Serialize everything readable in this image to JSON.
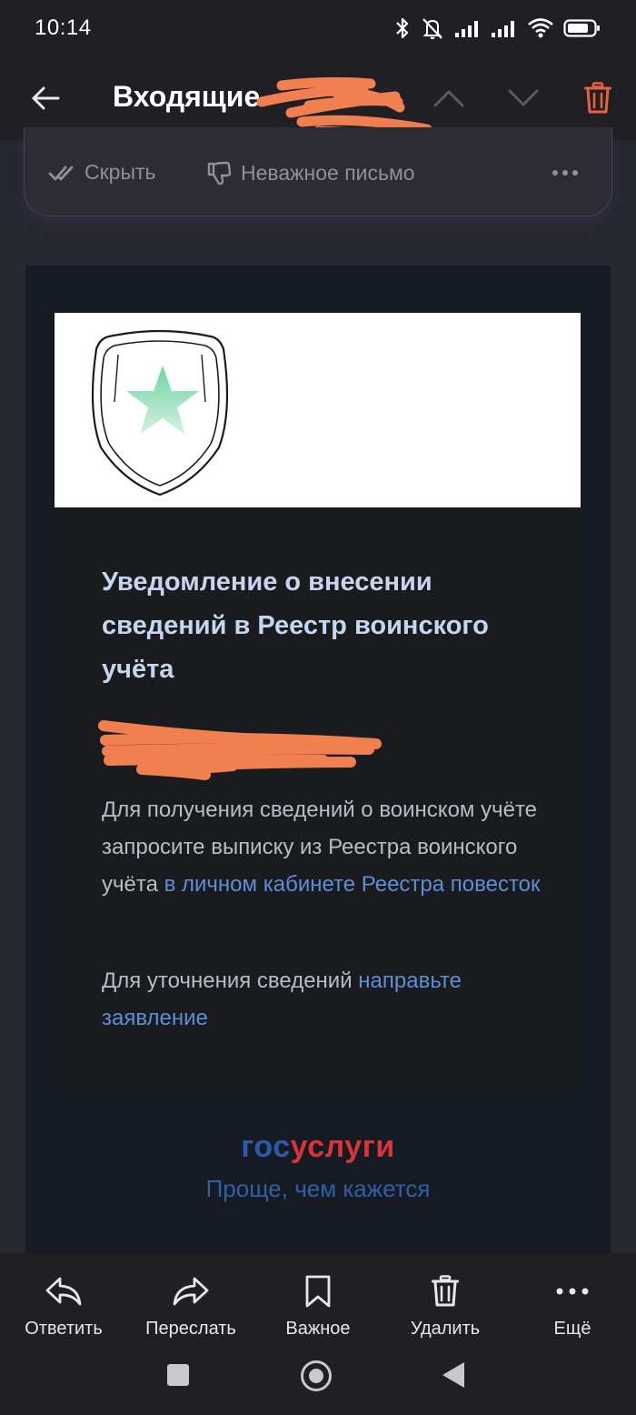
{
  "status_bar": {
    "time": "10:14",
    "icons": [
      "bluetooth-icon",
      "mute-icon",
      "signal-icon",
      "signal-icon",
      "wifi-icon",
      "battery-icon"
    ]
  },
  "header": {
    "title": "Входящие",
    "back_icon": "arrow-left",
    "prev_icon": "chevron-up",
    "next_icon": "chevron-down",
    "delete_icon": "trash",
    "delete_color": "#e8623c"
  },
  "action_card": {
    "hide_label": "Скрыть",
    "unimportant_label": "Неважное письмо",
    "more_icon": "more-horizontal"
  },
  "email": {
    "notice_title": "Уведомление о внесении сведений в Реестр воинского учёта",
    "p1_text": "Для получения сведений о воинском учёте запросите выписку из Реестра воинского учёта ",
    "p1_link": "в личном кабинете Реестра повесток",
    "p2_text": "Для уточнения сведений ",
    "p2_link": "направьте заявление",
    "logo_part1": "гос",
    "logo_part2": "услуги",
    "slogan": "Проще, чем кажется",
    "link_color": "#5e8ed6"
  },
  "toolbar": {
    "reply_label": "Ответить",
    "forward_label": "Переслать",
    "important_label": "Важное",
    "delete_label": "Удалить",
    "more_label": "Ещё"
  },
  "redaction_color": "#f0804f"
}
